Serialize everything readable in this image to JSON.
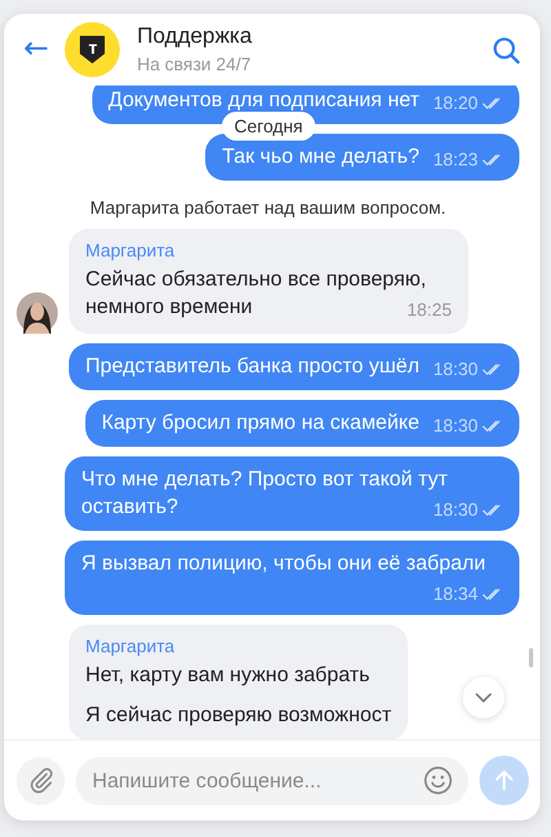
{
  "header": {
    "back": "←",
    "logo_letter": "т",
    "title": "Поддержка",
    "subtitle": "На связи 24/7"
  },
  "date_label": "Сегодня",
  "messages": [
    {
      "kind": "outgoing",
      "paragraphs": [
        "Документов для подписания нет"
      ],
      "time": "18:20",
      "read": true
    },
    {
      "kind": "outgoing",
      "paragraphs": [
        "Так чьо мне делать?"
      ],
      "time": "18:23",
      "read": true
    },
    {
      "kind": "system",
      "paragraphs": [
        "Маргарита работает над вашим вопросом."
      ]
    },
    {
      "kind": "incoming",
      "author": "Маргарита",
      "paragraphs": [
        "Сейчас обязательно все проверяю, немного времени"
      ],
      "time": "18:25"
    },
    {
      "kind": "outgoing",
      "paragraphs": [
        "Представитель банка просто ушёл"
      ],
      "time": "18:30",
      "read": true
    },
    {
      "kind": "outgoing",
      "paragraphs": [
        "Карту бросил прямо на скамейке"
      ],
      "time": "18:30",
      "read": true
    },
    {
      "kind": "outgoing",
      "paragraphs": [
        "Что мне делать? Просто вот такой тут оставить?"
      ],
      "time": "18:30",
      "read": true
    },
    {
      "kind": "outgoing",
      "paragraphs": [
        "Я вызвал полицию, чтобы они её забрали"
      ],
      "time": "18:34",
      "read": true
    },
    {
      "kind": "incoming",
      "author": "Маргарита",
      "paragraphs": [
        "Нет, карту вам нужно забрать",
        "Я сейчас проверяю возможност"
      ]
    }
  ],
  "composer": {
    "placeholder": "Напишите сообщение..."
  }
}
